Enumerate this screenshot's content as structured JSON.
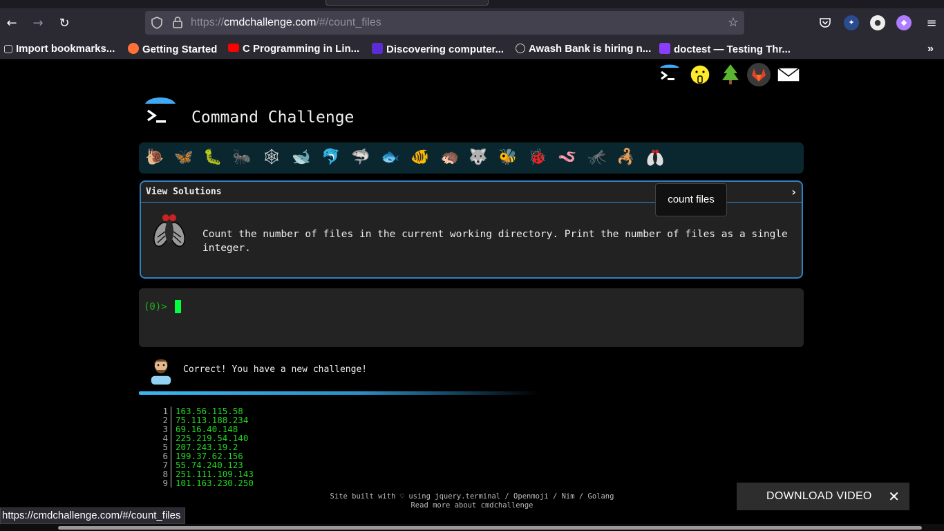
{
  "browser": {
    "url_scheme": "https://",
    "url_host": "cmdchallenge.com",
    "url_path": "/#/count_files",
    "bookmarks": [
      {
        "label": "Import bookmarks...",
        "icon": "import-icon",
        "color": "#cccccc"
      },
      {
        "label": "Getting Started",
        "icon": "firefox-icon",
        "color": "#ff7139"
      },
      {
        "label": "C Programming in Lin...",
        "icon": "youtube-icon",
        "color": "#ff0000"
      },
      {
        "label": "Discovering computer...",
        "icon": "shield-bookmark-icon",
        "color": "#5b2bd6"
      },
      {
        "label": "Awash Bank is hiring n...",
        "icon": "globe-icon",
        "color": "#cccccc"
      },
      {
        "label": "doctest — Testing Thr...",
        "icon": "grid-icon",
        "color": "#8b3dff"
      }
    ],
    "status_url": "https://cmdchallenge.com/#/count_files"
  },
  "site": {
    "title": "Command Challenge",
    "social_icons": [
      "cmdchallenge-icon",
      "shush-face-icon",
      "tree-icon",
      "gitlab-icon",
      "mail-icon"
    ],
    "levels": [
      "snail-icon",
      "butterfly-icon",
      "caterpillar-icon",
      "ant-icon",
      "web-icon",
      "whale-icon",
      "dolphin-icon",
      "shark-icon",
      "fish-icon",
      "tropical-fish-icon",
      "hedgehog-icon",
      "wolf-icon",
      "bee-icon",
      "ladybug-icon",
      "worm-icon",
      "mosquito-icon",
      "scorpion-icon",
      "fly-icon"
    ]
  },
  "challenge": {
    "panel_label": "View Solutions",
    "expand_glyph": "›",
    "tooltip": "count files",
    "description": "Count the number of files in the current working directory. Print the number of files as a single integer."
  },
  "terminal": {
    "prompt": "(0)>"
  },
  "feedback": {
    "message": "Correct! You have a new challenge!"
  },
  "output_lines": [
    {
      "n": "1",
      "ip": "163.56.115.58"
    },
    {
      "n": "2",
      "ip": "75.113.188.234"
    },
    {
      "n": "3",
      "ip": "69.16.40.148"
    },
    {
      "n": "4",
      "ip": "225.219.54.140"
    },
    {
      "n": "5",
      "ip": "207.243.19.2"
    },
    {
      "n": "6",
      "ip": "199.37.62.156"
    },
    {
      "n": "7",
      "ip": "55.74.240.123"
    },
    {
      "n": "8",
      "ip": "251.111.109.143"
    },
    {
      "n": "9",
      "ip": "101.163.230.250"
    }
  ],
  "footer": {
    "line1": "Site built with ♡ using jquery.terminal / Openmoji / Nim / Golang",
    "line2": "Read more about cmdchallenge"
  },
  "download": {
    "label": "DOWNLOAD VIDEO",
    "close_glyph": "✕"
  },
  "colors": {
    "accent": "#2f82c4",
    "prompt_green": "#1fb41f",
    "cursor_green": "#00ff3c",
    "output_green": "#22d822"
  }
}
